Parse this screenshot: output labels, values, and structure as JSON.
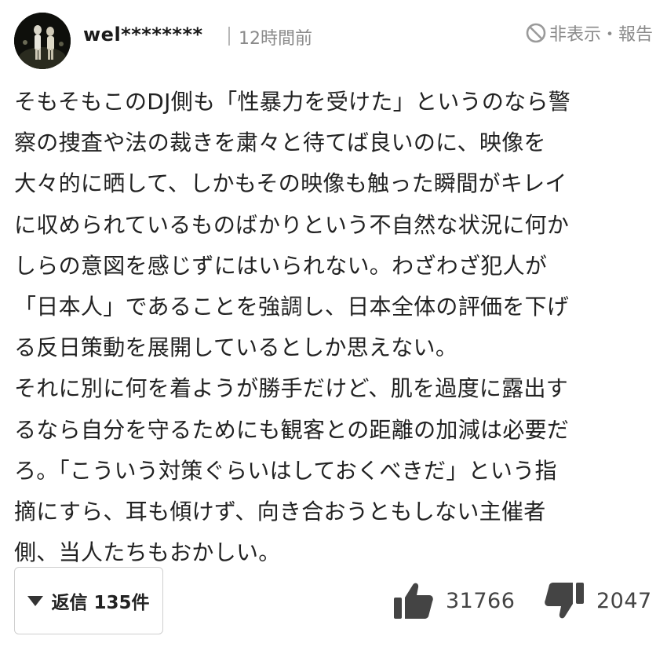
{
  "comment": {
    "username": "wel********",
    "time": "12時間前",
    "hide_report": "非表示・報告",
    "lines": [
      "そもそもこのDJ側も「性暴力を受けた」というのなら警",
      "察の捜査や法の裁きを粛々と待てば良いのに、映像を",
      "大々的に晒して、しかもその映像も触った瞬間がキレイ",
      "に収められているものばかりという不自然な状況に何か",
      "しらの意図を感じずにはいられない。わざわざ犯人が",
      "「日本人」であることを強調し、日本全体の評価を下げ",
      "る反日策動を展開しているとしか思えない。",
      "それに別に何を着ようが勝手だけど、肌を過度に露出す",
      "るなら自分を守るためにも観客との距離の加減は必要だ",
      "ろ。「こういう対策ぐらいはしておくべきだ」という指",
      "摘にすら、耳も傾けず、向き合おうともしない主催者",
      "側、当人たちもおかしい。"
    ],
    "replies_label": "返信 135件",
    "likes": "31766",
    "dislikes": "2047"
  },
  "icons": {
    "hide": "prohibit-icon",
    "replies": "triangle-down-icon",
    "like": "thumbs-up-icon",
    "dislike": "thumbs-down-icon"
  },
  "colors": {
    "text": "#222222",
    "muted": "#8a8a8a",
    "icon": "#444444",
    "border": "#cfcfcf"
  }
}
